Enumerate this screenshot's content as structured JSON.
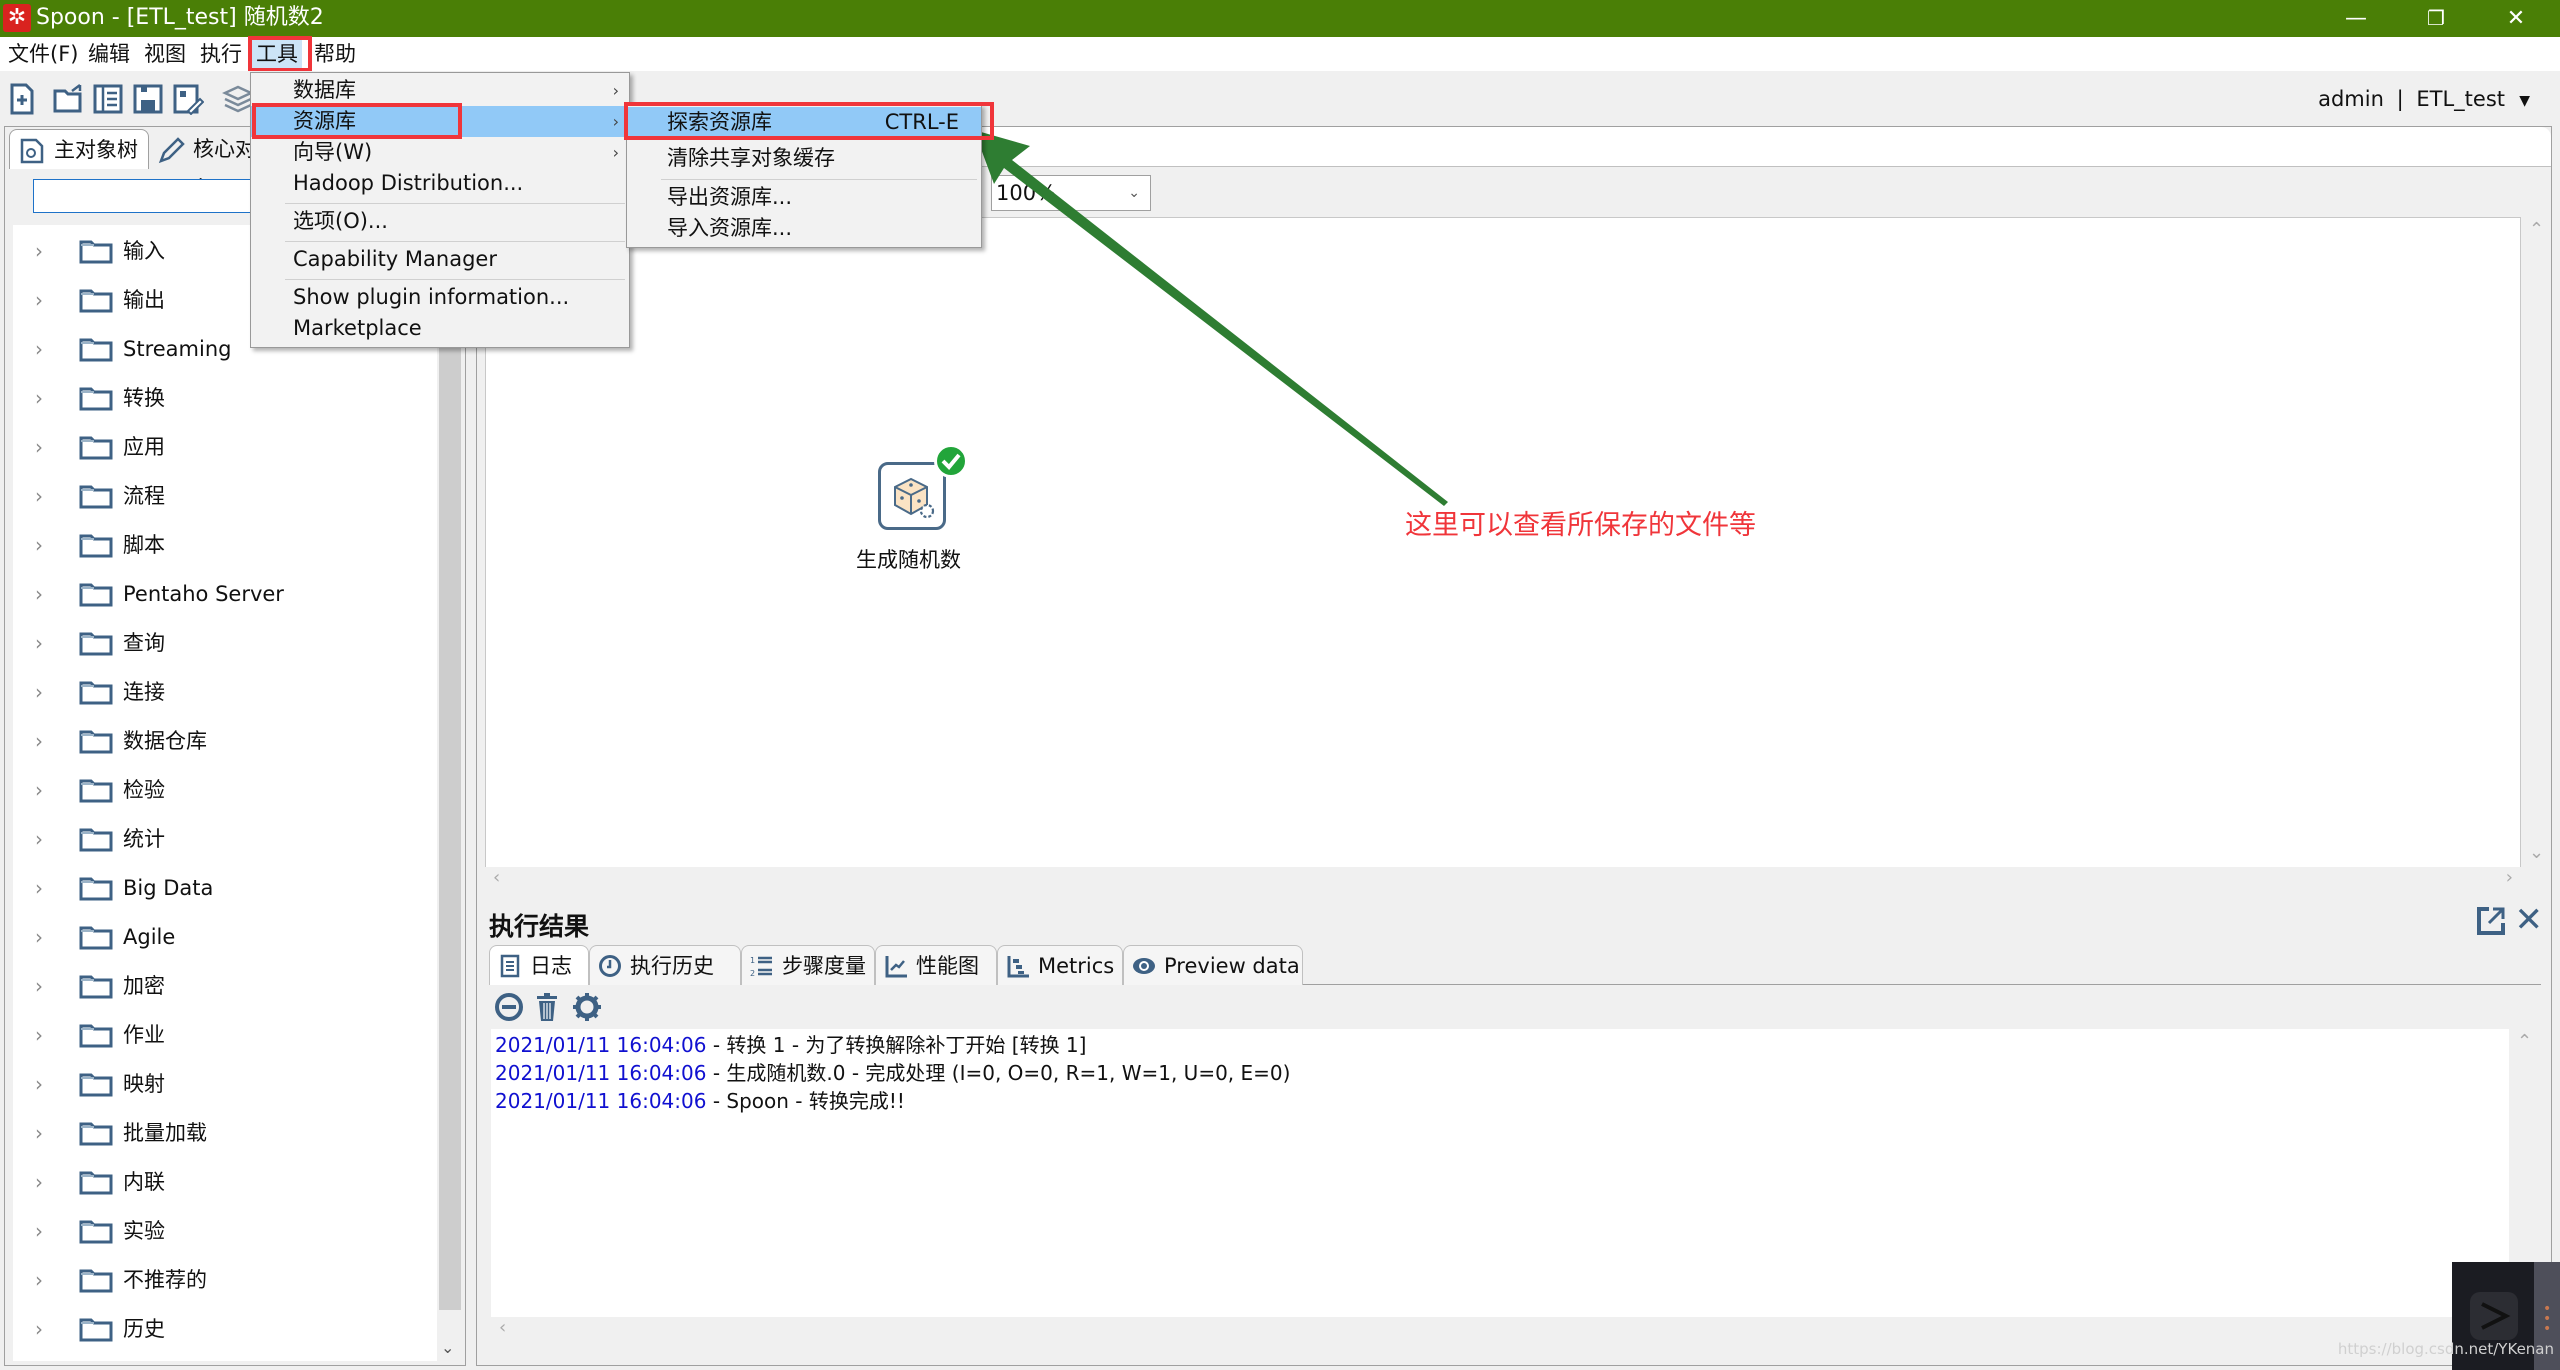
{
  "window": {
    "title": "Spoon - [ETL_test] 随机数2",
    "logo_glyph": "✲",
    "controls": {
      "minimize": "—",
      "restore": "❐",
      "close": "✕"
    }
  },
  "menubar": {
    "items": [
      {
        "label": "文件(F)"
      },
      {
        "label": "编辑"
      },
      {
        "label": "视图"
      },
      {
        "label": "执行"
      },
      {
        "label": "工具",
        "active": true
      },
      {
        "label": "帮助"
      }
    ]
  },
  "toolbar": {
    "icons": [
      "new-file-icon",
      "open-file-icon",
      "explore-icon",
      "save-icon",
      "save-as-icon",
      "layers-icon"
    ],
    "user": "admin",
    "separator": "|",
    "repository": "ETL_test",
    "caret": "▼"
  },
  "tools_menu": {
    "items": [
      {
        "label": "数据库",
        "submenu": true
      },
      {
        "label": "资源库",
        "submenu": true,
        "highlighted": true
      },
      {
        "label": "向导(W)",
        "submenu": true
      },
      {
        "label": "Hadoop Distribution..."
      },
      {
        "label": "选项(O)..."
      },
      {
        "label": "Capability Manager"
      },
      {
        "label": "Show plugin information..."
      },
      {
        "label": "Marketplace"
      }
    ],
    "arrow": "›"
  },
  "repository_submenu": {
    "items": [
      {
        "label": "探索资源库",
        "shortcut": "CTRL-E",
        "highlighted": true
      },
      {
        "label": "清除共享对象缓存"
      },
      {
        "label": "导出资源库..."
      },
      {
        "label": "导入资源库..."
      }
    ]
  },
  "left_panel": {
    "tabs": [
      {
        "label": "主对象树",
        "active": true
      },
      {
        "label": "核心对象"
      }
    ],
    "search": {
      "value": "",
      "placeholder": ""
    },
    "tree": [
      "输入",
      "输出",
      "Streaming",
      "转换",
      "应用",
      "流程",
      "脚本",
      "Pentaho Server",
      "查询",
      "连接",
      "数据仓库",
      "检验",
      "统计",
      "Big Data",
      "Agile",
      "加密",
      "作业",
      "映射",
      "批量加载",
      "内联",
      "实验",
      "不推荐的",
      "历史"
    ],
    "expand_glyph": "›",
    "scroll_down": "⌄"
  },
  "canvas": {
    "zoom": "100%",
    "zoom_caret": "⌄",
    "step": {
      "label": "生成随机数",
      "status": "success"
    },
    "annotation": "这里可以查看所保存的文件等",
    "annotation_color": "#f0353a",
    "arrow_color": "#2e7d32"
  },
  "results": {
    "title": "执行结果",
    "tabs": [
      {
        "label": "日志",
        "icon": "log-icon",
        "active": true
      },
      {
        "label": "执行历史",
        "icon": "clock-icon"
      },
      {
        "label": "步骤度量",
        "icon": "numbered-list-icon"
      },
      {
        "label": "性能图",
        "icon": "line-chart-icon"
      },
      {
        "label": "Metrics",
        "icon": "metrics-icon"
      },
      {
        "label": "Preview data",
        "icon": "eye-icon"
      }
    ],
    "log": [
      {
        "ts": "2021/01/11 16:04:06",
        "msg": " - 转换 1 - 为了转换解除补丁开始  [转换 1]"
      },
      {
        "ts": "2021/01/11 16:04:06",
        "msg": " - 生成随机数.0 - 完成处理 (I=0, O=0, R=1, W=1, U=0, E=0)"
      },
      {
        "ts": "2021/01/11 16:04:06",
        "msg": " - Spoon - 转换完成!!"
      }
    ]
  },
  "watermark": "https://blog.csdn.net/YKenan",
  "colors": {
    "titlebar": "#4a7f06",
    "highlight": "#91c9f7",
    "red_box": "#f0353a",
    "log_timestamp": "#1010d0",
    "icon_blue": "#3e6184"
  }
}
